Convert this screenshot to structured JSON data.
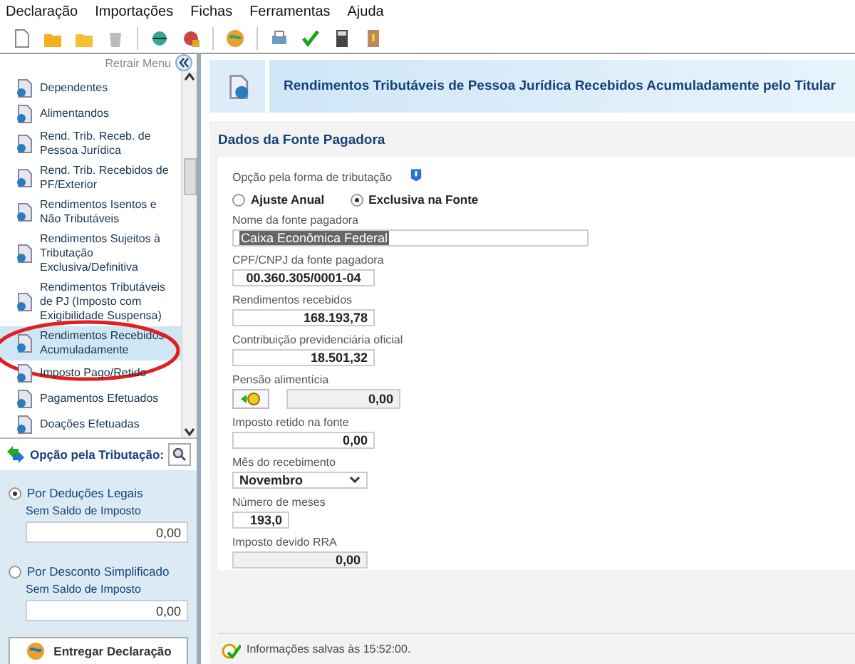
{
  "menu": [
    "Declaração",
    "Importações",
    "Fichas",
    "Ferramentas",
    "Ajuda"
  ],
  "sidebar": {
    "collapse_label": "Retrair Menu",
    "items": [
      {
        "label": "Dependentes",
        "selected": false
      },
      {
        "label": "Alimentandos",
        "selected": false
      },
      {
        "label": "Rend. Trib. Receb. de Pessoa Jurídica",
        "selected": false
      },
      {
        "label": "Rend. Trib. Recebidos de PF/Exterior",
        "selected": false
      },
      {
        "label": "Rendimentos Isentos e Não Tributáveis",
        "selected": false
      },
      {
        "label": "Rendimentos Sujeitos à Tributação Exclusiva/Definitiva",
        "selected": false
      },
      {
        "label": "Rendimentos Tributáveis de PJ (Imposto com Exigibilidade Suspensa)",
        "selected": false
      },
      {
        "label": "Rendimentos Recebidos Acumuladamente",
        "selected": true
      },
      {
        "label": "Imposto Pago/Retido",
        "selected": false
      },
      {
        "label": "Pagamentos Efetuados",
        "selected": false
      },
      {
        "label": "Doações Efetuadas",
        "selected": false
      }
    ],
    "tax_option": {
      "title": "Opção pela Tributação:",
      "options": [
        {
          "label": "Por Deduções Legais",
          "selected": true,
          "balance_label": "Sem Saldo de Imposto",
          "value": "0,00"
        },
        {
          "label": "Por Desconto Simplificado",
          "selected": false,
          "balance_label": "Sem Saldo de Imposto",
          "value": "0,00"
        }
      ]
    },
    "submit_button": "Entregar Declaração"
  },
  "page": {
    "title": "Rendimentos Tributáveis de Pessoa Jurídica Recebidos Acumuladamente pelo Titular",
    "section_title": "Dados da Fonte Pagadora",
    "tax_form": {
      "label": "Opção pela forma de tributação",
      "options": [
        {
          "label": "Ajuste Anual",
          "selected": false
        },
        {
          "label": "Exclusiva na Fonte",
          "selected": true
        }
      ]
    },
    "fields": [
      {
        "kind": "name",
        "label": "Nome da fonte pagadora",
        "value": "Caixa Econômica Federal"
      },
      {
        "kind": "id",
        "label": "CPF/CNPJ da fonte pagadora",
        "value": "00.360.305/0001-04"
      },
      {
        "kind": "amount",
        "label": "Rendimentos recebidos",
        "value": "168.193,78"
      },
      {
        "kind": "amount",
        "label": "Contribuição previdenciária oficial",
        "value": "18.501,32"
      },
      {
        "kind": "linked",
        "label": "Pensão alimentícia",
        "value": "0,00"
      },
      {
        "kind": "amount",
        "label": "Imposto retido na fonte",
        "value": "0,00"
      },
      {
        "kind": "dropdown",
        "label": "Mês do recebimento",
        "value": "Novembro"
      },
      {
        "kind": "short",
        "label": "Número de meses",
        "value": "193,0"
      },
      {
        "kind": "readonly",
        "label": "Imposto devido RRA",
        "value": "0,00"
      }
    ]
  },
  "status_bar": "Informações salvas às 15:52:00."
}
